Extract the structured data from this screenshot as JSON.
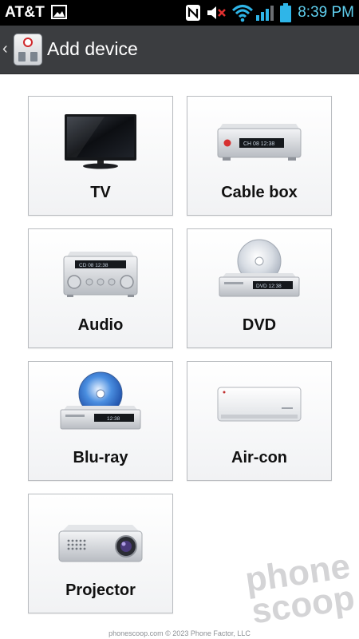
{
  "status_bar": {
    "carrier": "AT&T",
    "time": "8:39 PM",
    "icons": [
      "image-icon",
      "nfc-icon",
      "mute-icon",
      "wifi-icon",
      "signal-icon",
      "battery-icon"
    ]
  },
  "action_bar": {
    "title": "Add device",
    "app_icon": "remote-control-icon",
    "back_icon": "chevron-left-icon"
  },
  "devices": [
    {
      "label": "TV",
      "icon": "tv-icon"
    },
    {
      "label": "Cable box",
      "icon": "cable-box-icon"
    },
    {
      "label": "Audio",
      "icon": "audio-icon"
    },
    {
      "label": "DVD",
      "icon": "dvd-icon"
    },
    {
      "label": "Blu-ray",
      "icon": "blu-ray-icon"
    },
    {
      "label": "Air-con",
      "icon": "air-con-icon"
    },
    {
      "label": "Projector",
      "icon": "projector-icon"
    }
  ],
  "device_displays": {
    "cable": "CH 08  12:38",
    "audio": "CD 08  12:38",
    "dvd": "DVD  12:38",
    "bluray": "12:38"
  },
  "watermark": {
    "line1": "phone",
    "line2": "scoop"
  },
  "footer": "phonescoop.com  © 2023 Phone Factor, LLC"
}
